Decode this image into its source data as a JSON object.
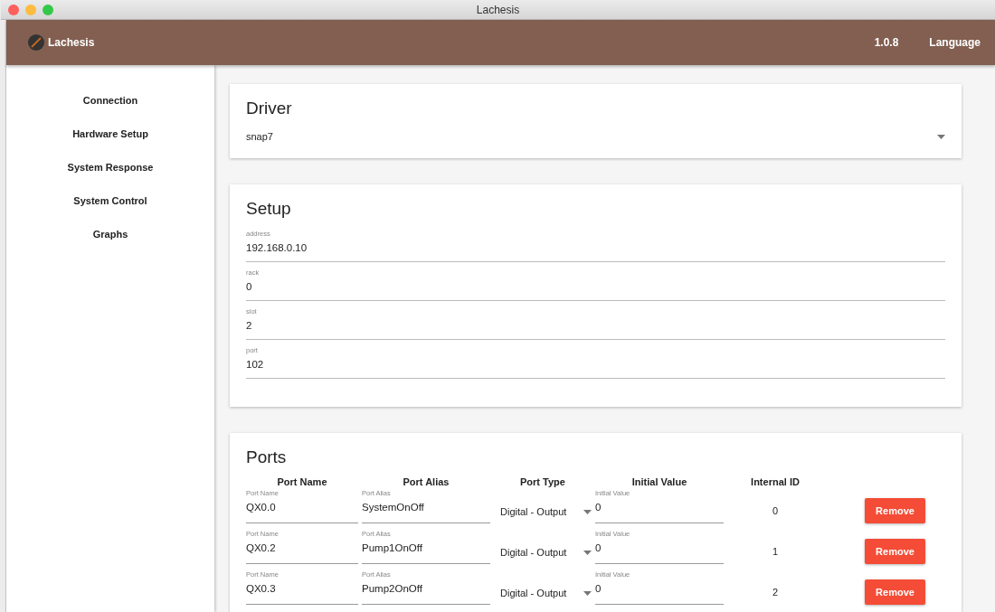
{
  "window": {
    "title": "Lachesis"
  },
  "app_bar": {
    "title": "Lachesis",
    "version": "1.0.8",
    "language": "Language"
  },
  "sidebar": {
    "items": [
      {
        "label": "Connection"
      },
      {
        "label": "Hardware Setup"
      },
      {
        "label": "System Response"
      },
      {
        "label": "System Control"
      },
      {
        "label": "Graphs"
      }
    ]
  },
  "driver": {
    "title": "Driver",
    "value": "snap7"
  },
  "setup": {
    "title": "Setup",
    "fields": [
      {
        "label": "address",
        "value": "192.168.0.10"
      },
      {
        "label": "rack",
        "value": "0"
      },
      {
        "label": "slot",
        "value": "2"
      },
      {
        "label": "port",
        "value": "102"
      }
    ]
  },
  "ports": {
    "title": "Ports",
    "columns": [
      "Port Name",
      "Port Alias",
      "Port Type",
      "Initial Value",
      "Internal ID"
    ],
    "rows": [
      {
        "name_label": "Port Name",
        "name": "QX0.0",
        "alias_label": "Port Alias",
        "alias": "SystemOnOff",
        "type": "Digital - Output",
        "initial_label": "Initial Value",
        "initial": "0",
        "id": "0",
        "button": "Remove"
      },
      {
        "name_label": "Port Name",
        "name": "QX0.2",
        "alias_label": "Port Alias",
        "alias": "Pump1OnOff",
        "type": "Digital - Output",
        "initial_label": "Initial Value",
        "initial": "0",
        "id": "1",
        "button": "Remove"
      },
      {
        "name_label": "Port Name",
        "name": "QX0.3",
        "alias_label": "Port Alias",
        "alias": "Pump2OnOff",
        "type": "Digital - Output",
        "initial_label": "Initial Value",
        "initial": "0",
        "id": "2",
        "button": "Remove"
      }
    ]
  }
}
